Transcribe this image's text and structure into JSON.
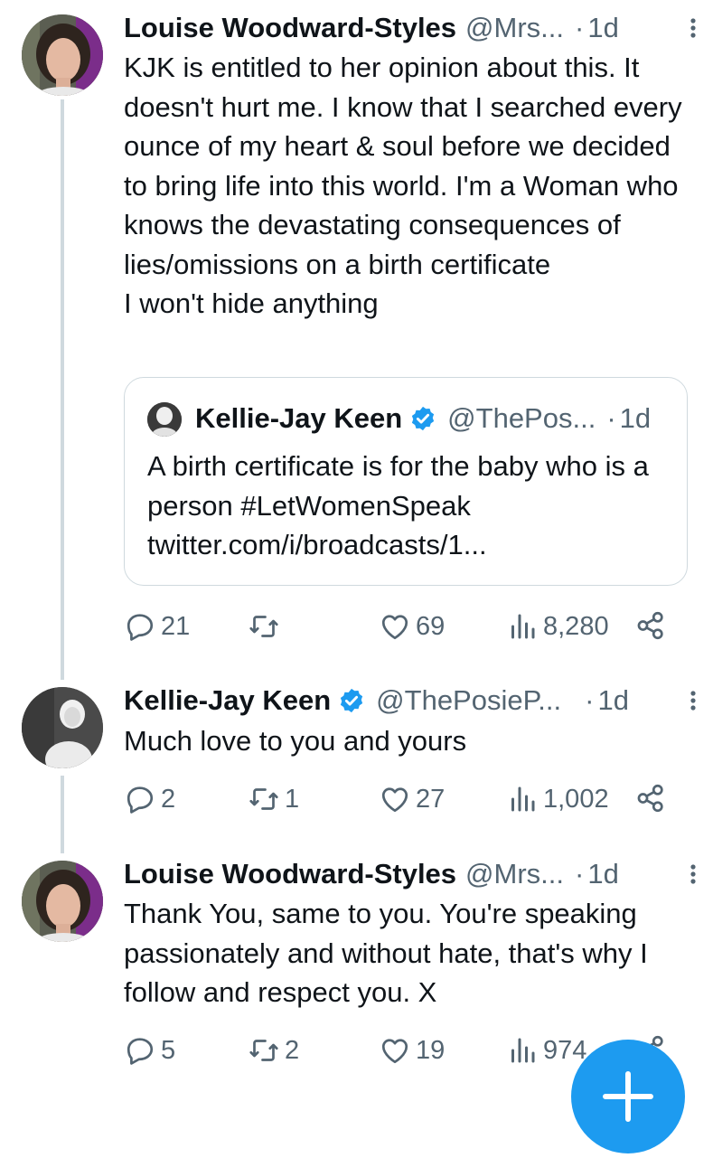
{
  "colors": {
    "text": "#0f1419",
    "secondary": "#536471",
    "border": "#cfd9de",
    "accent": "#1d9bf0"
  },
  "tweets": [
    {
      "name": "Louise Woodward-Styles",
      "handle": "@Mrs...",
      "dot": "·",
      "time": "1d",
      "verified": false,
      "text": "KJK is entitled to her opinion about this. It doesn't hurt me. I know that I searched every ounce of my heart & soul before we decided to bring life into this world. I'm a Woman who knows the devastating consequences of lies/omissions on a birth certificate\n I won't hide anything",
      "quote": {
        "name": "Kellie-Jay Keen",
        "handle": "@ThePos...",
        "dot": "·",
        "time": "1d",
        "verified": true,
        "text": "A birth certificate is for the baby who is a person #LetWomenSpeak twitter.com/i/broadcasts/1..."
      },
      "stats": {
        "replies": "21",
        "retweets": "",
        "likes": "69",
        "views": "8,280"
      },
      "icons": [
        "reply-icon",
        "retweet-icon",
        "like-icon",
        "views-icon",
        "share-icon"
      ]
    },
    {
      "name": "Kellie-Jay Keen",
      "handle": "@ThePosieP...",
      "dot": "·",
      "time": "1d",
      "verified": true,
      "text": "Much love to you and yours",
      "stats": {
        "replies": "2",
        "retweets": "1",
        "likes": "27",
        "views": "1,002"
      },
      "icons": [
        "reply-icon",
        "retweet-icon",
        "like-icon",
        "views-icon",
        "share-icon"
      ]
    },
    {
      "name": "Louise Woodward-Styles",
      "handle": "@Mrs...",
      "dot": "·",
      "time": "1d",
      "verified": false,
      "text": "Thank You, same to you. You're speaking passionately and without hate, that's why I follow and respect you. X",
      "stats": {
        "replies": "5",
        "retweets": "2",
        "likes": "19",
        "views": "974"
      },
      "icons": [
        "reply-icon",
        "retweet-icon",
        "like-icon",
        "views-icon",
        "share-icon"
      ]
    }
  ],
  "fab": {
    "icon": "compose-plus-icon"
  }
}
